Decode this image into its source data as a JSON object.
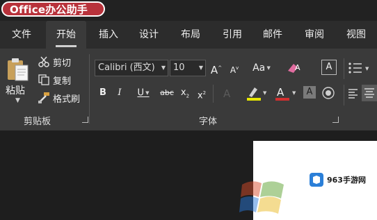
{
  "title_strip": {
    "brand": "Office办公助手"
  },
  "tabs": [
    {
      "label": "文件",
      "active": false
    },
    {
      "label": "开始",
      "active": true
    },
    {
      "label": "插入",
      "active": false
    },
    {
      "label": "设计",
      "active": false
    },
    {
      "label": "布局",
      "active": false
    },
    {
      "label": "引用",
      "active": false
    },
    {
      "label": "邮件",
      "active": false
    },
    {
      "label": "审阅",
      "active": false
    },
    {
      "label": "视图",
      "active": false
    }
  ],
  "clipboard": {
    "paste_label": "粘贴",
    "cut_label": "剪切",
    "copy_label": "复制",
    "format_painter_label": "格式刷",
    "group_label": "剪贴板"
  },
  "font": {
    "font_name": "Calibri (西文)",
    "font_size": "10",
    "grow_label": "A",
    "shrink_label": "A",
    "change_case_label": "Aa",
    "bold_label": "B",
    "italic_label": "I",
    "underline_label": "U",
    "strikethrough_label": "abc",
    "subscript_label": "x",
    "superscript_label": "x",
    "font_color_label": "A",
    "char_shading_label": "A",
    "char_border_label": "A",
    "group_label": "字体"
  },
  "colors": {
    "brand_red": "#b8323b",
    "highlight_yellow": "#e6e600",
    "font_color_red": "#d32f2f",
    "pink_eraser": "#e06c9f"
  },
  "watermark": {
    "site": "963手游网"
  }
}
